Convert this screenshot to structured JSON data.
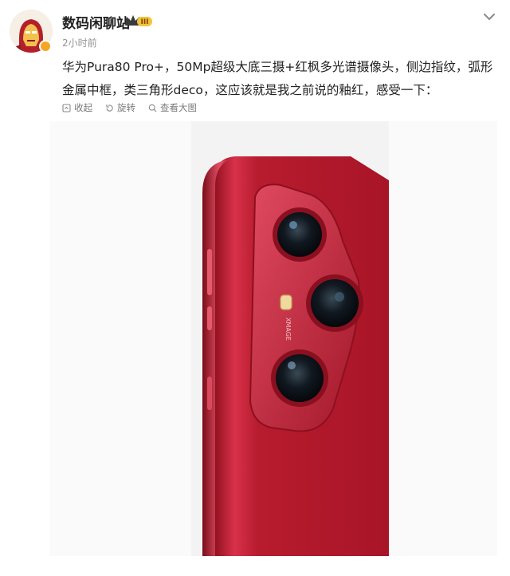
{
  "user": {
    "name": "数码闲聊站",
    "level_badge": "III",
    "time": "2小时前"
  },
  "post": {
    "text": "华为Pura80 Pro+，50Mp超级大底三摄+红枫多光谱摄像头，侧边指纹，弧形金属中框，类三角形deco，这应该就是我之前说的釉红，感受一下："
  },
  "actions": [
    {
      "label": "收起",
      "icon": "collapse-icon"
    },
    {
      "label": "旋转",
      "icon": "rotate-icon"
    },
    {
      "label": "查看大图",
      "icon": "zoom-icon"
    }
  ],
  "image": {
    "brand_mark": "XMAGE"
  },
  "colors": {
    "phone_red": "#c41e2e",
    "badge_orange": "#f5a623",
    "meta_gray": "#939393"
  }
}
